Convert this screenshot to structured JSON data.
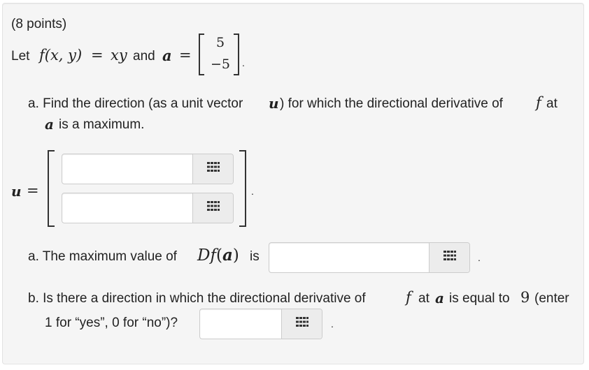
{
  "points_label": "(8 points)",
  "intro": {
    "let": "Let",
    "f_def": "f(x, y)",
    "equals1": "=",
    "expr": "xy",
    "and": "and",
    "a": "a",
    "equals2": "=",
    "vec_top": "5",
    "vec_bottom": "−5",
    "period": "."
  },
  "part_a1": {
    "line1_pre": "a. Find the direction (as a unit vector",
    "u": "u",
    "line1_mid": ") for which the directional derivative of",
    "f": "f",
    "line1_post": "at",
    "a": "a",
    "line2": "is a maximum."
  },
  "u_vector": {
    "label": "u",
    "equals": "=",
    "entry1_value": "",
    "entry2_value": "",
    "period": "."
  },
  "part_a2": {
    "pre": "a. The maximum value of",
    "expr_D": "Df",
    "expr_open": "(",
    "expr_a": "a",
    "expr_close": ")",
    "is": "is",
    "value": "",
    "period": "."
  },
  "part_b": {
    "line1_pre": "b. Is there a direction in which the directional derivative of",
    "f": "f",
    "at": "at",
    "a": "a",
    "line1_post": "is equal to",
    "nine": "9",
    "enter": "(enter",
    "line2": "1 for “yes”, 0 for “no”)?",
    "value": "",
    "period": "."
  },
  "icons": {
    "palette": "grid-palette-icon"
  }
}
